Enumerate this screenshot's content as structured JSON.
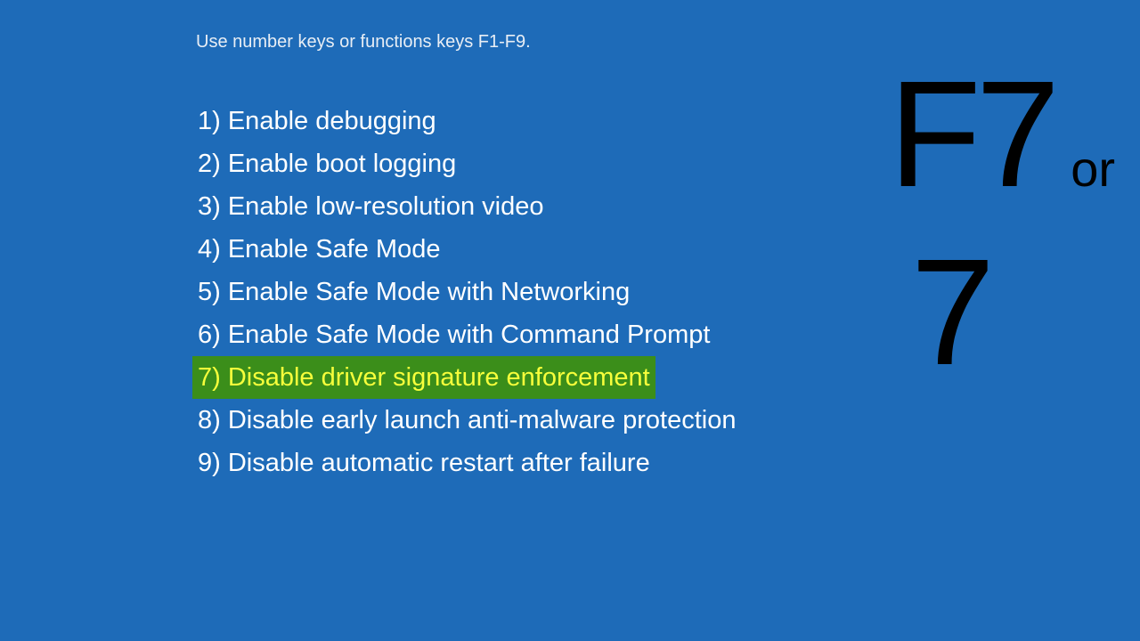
{
  "instruction": "Use number keys or functions keys F1-F9.",
  "menu": {
    "items": [
      {
        "label": "1) Enable debugging",
        "highlighted": false
      },
      {
        "label": "2) Enable boot logging",
        "highlighted": false
      },
      {
        "label": "3) Enable low-resolution video",
        "highlighted": false
      },
      {
        "label": "4) Enable Safe Mode",
        "highlighted": false
      },
      {
        "label": "5) Enable Safe Mode with Networking",
        "highlighted": false
      },
      {
        "label": "6) Enable Safe Mode with Command Prompt",
        "highlighted": false
      },
      {
        "label": "7) Disable driver signature enforcement",
        "highlighted": true
      },
      {
        "label": "8) Disable early launch anti-malware protection",
        "highlighted": false
      },
      {
        "label": "9) Disable automatic restart after failure",
        "highlighted": false
      }
    ]
  },
  "overlay": {
    "key_function": "F7",
    "or": "or",
    "key_number": "7"
  }
}
